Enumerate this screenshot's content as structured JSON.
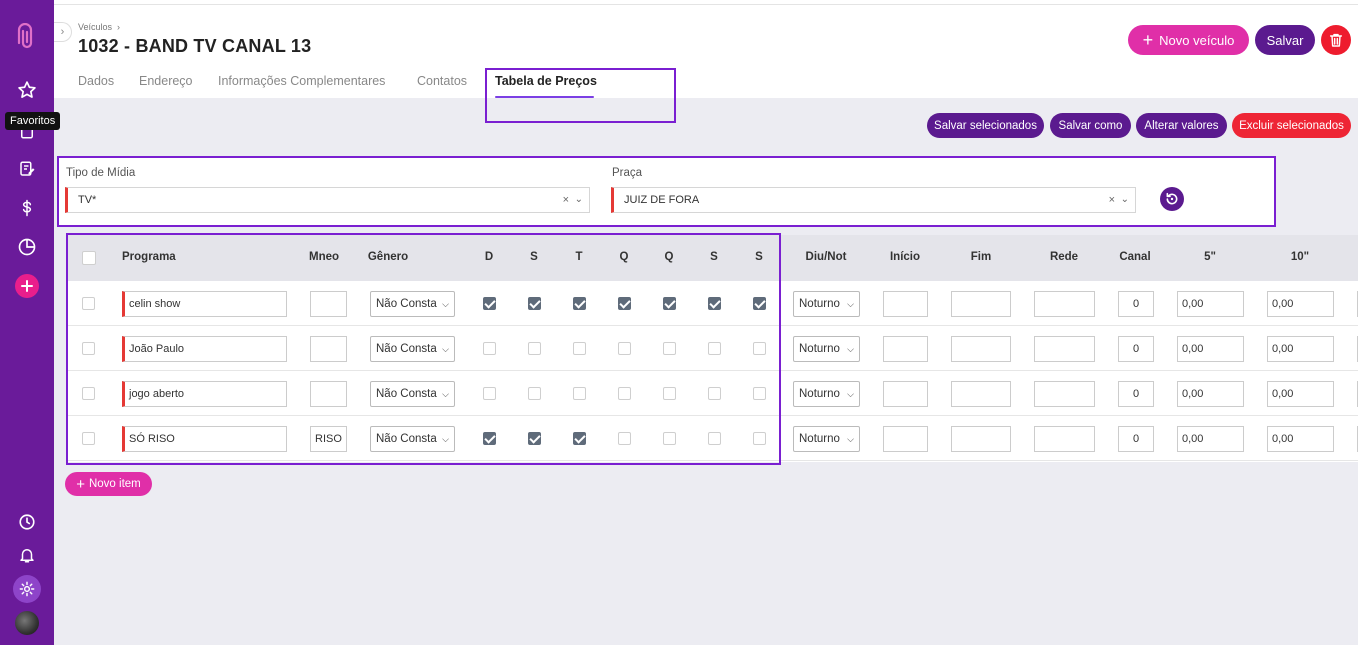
{
  "sidebar": {
    "tooltip": "Favoritos",
    "icons": [
      "logo-icon",
      "star-icon",
      "document-icon",
      "edit-icon",
      "dollar-icon",
      "pie-chart-icon",
      "plus-icon",
      "clock-icon",
      "bell-icon",
      "gear-icon",
      "avatar"
    ]
  },
  "header": {
    "breadcrumb": "Veículos",
    "title": "1032 - BAND TV CANAL 13",
    "novo_label": "Novo veículo",
    "salvar_label": "Salvar"
  },
  "tabs": [
    {
      "label": "Dados"
    },
    {
      "label": "Endereço"
    },
    {
      "label": "Informações Complementares"
    },
    {
      "label": "Contatos"
    },
    {
      "label": "Tabela de Preços",
      "active": true
    }
  ],
  "actions": {
    "salvar_sel": "Salvar selecionados",
    "salvar_como": "Salvar como",
    "alterar": "Alterar valores",
    "excluir": "Excluir selecionados"
  },
  "filters": {
    "tipo_label": "Tipo de Mídia",
    "tipo_value": "TV*",
    "praca_label": "Praça",
    "praca_value": "JUIZ DE FORA",
    "clear": "×",
    "caret": "⌄"
  },
  "table": {
    "headers": {
      "programa": "Programa",
      "mneo": "Mneo",
      "genero": "Gênero",
      "days": [
        "D",
        "S",
        "T",
        "Q",
        "Q",
        "S",
        "S"
      ],
      "diunot": "Diu/Not",
      "inicio": "Início",
      "fim": "Fim",
      "rede": "Rede",
      "canal": "Canal",
      "s5": "5\"",
      "s10": "10\""
    },
    "rows": [
      {
        "programa": "celin show",
        "mneo": "",
        "genero": "Não Consta",
        "days": [
          true,
          true,
          true,
          true,
          true,
          true,
          true
        ],
        "diunot": "Noturno",
        "inicio": "",
        "fim": "",
        "rede": "",
        "canal": "0",
        "s5": "0,00",
        "s10": "0,00"
      },
      {
        "programa": "João Paulo",
        "mneo": "",
        "genero": "Não Consta",
        "days": [
          false,
          false,
          false,
          false,
          false,
          false,
          false
        ],
        "diunot": "Noturno",
        "inicio": "",
        "fim": "",
        "rede": "",
        "canal": "0",
        "s5": "0,00",
        "s10": "0,00"
      },
      {
        "programa": "jogo aberto",
        "mneo": "",
        "genero": "Não Consta",
        "days": [
          false,
          false,
          false,
          false,
          false,
          false,
          false
        ],
        "diunot": "Noturno",
        "inicio": "",
        "fim": "",
        "rede": "",
        "canal": "0",
        "s5": "0,00",
        "s10": "0,00"
      },
      {
        "programa": "SÓ RISO",
        "mneo": "RISO",
        "genero": "Não Consta",
        "days": [
          true,
          true,
          true,
          false,
          false,
          false,
          false
        ],
        "diunot": "Noturno",
        "inicio": "",
        "fim": "",
        "rede": "",
        "canal": "0",
        "s5": "0,00",
        "s10": "0,00"
      }
    ]
  },
  "novo_item_label": "Novo item",
  "colors": {
    "primary": "#6a1b9a",
    "accent": "#e02fa8",
    "danger": "#ee2535",
    "highlight": "#7a1fd1"
  }
}
